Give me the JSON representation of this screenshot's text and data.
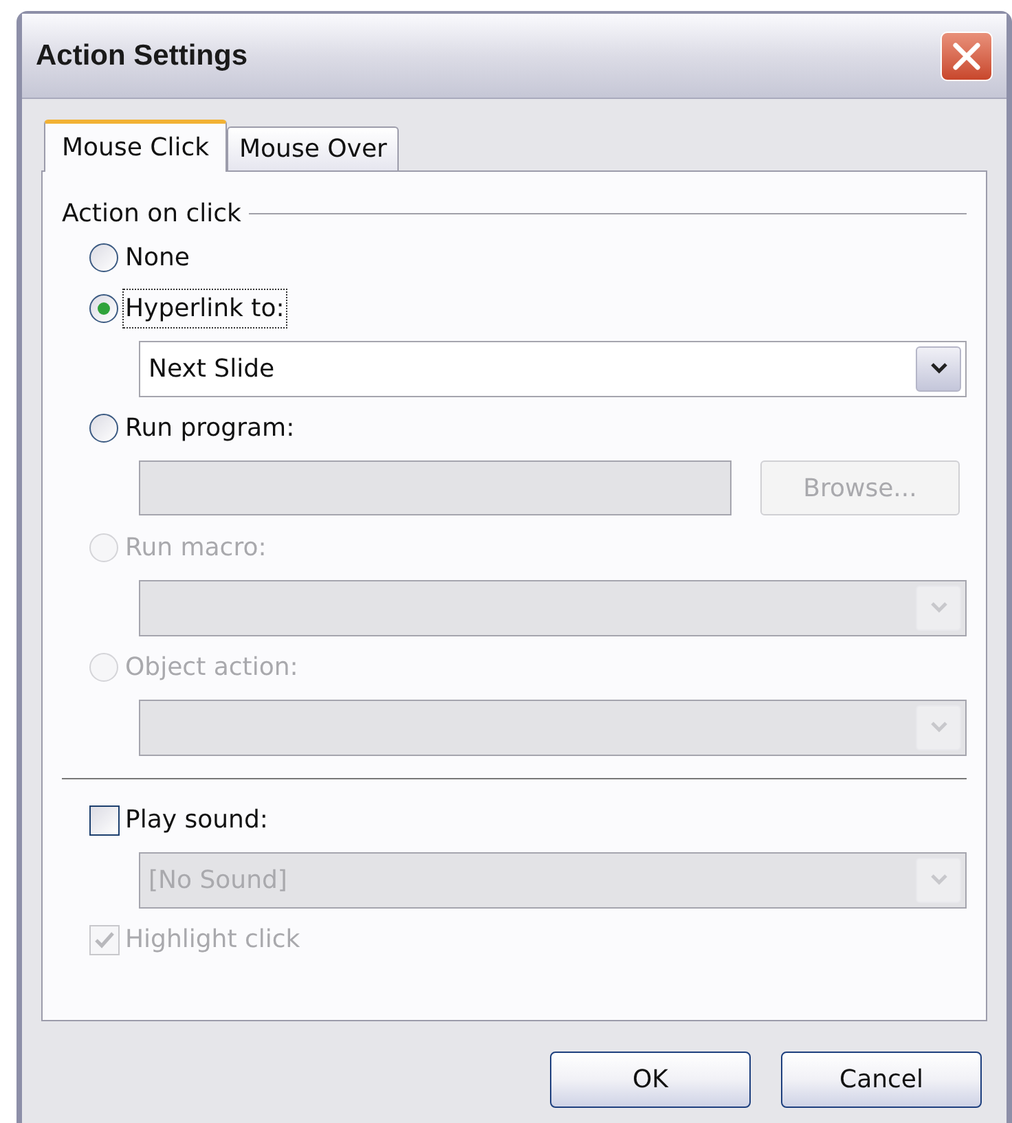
{
  "window": {
    "title": "Action Settings"
  },
  "tabs": [
    {
      "label": "Mouse Click",
      "selected": true
    },
    {
      "label": "Mouse Over",
      "selected": false
    }
  ],
  "group": {
    "label": "Action on click"
  },
  "options": [
    {
      "kind": "radio",
      "label": "None",
      "selected": false,
      "disabled": false
    },
    {
      "kind": "radio",
      "label": "Hyperlink to:",
      "selected": true,
      "disabled": false,
      "focused": true
    },
    {
      "kind": "dropdown",
      "value": "Next Slide",
      "disabled": false
    },
    {
      "kind": "radio",
      "label": "Run program:",
      "selected": false,
      "disabled": false
    },
    {
      "kind": "path",
      "button": "Browse...",
      "disabled": true
    },
    {
      "kind": "radio",
      "label": "Run macro:",
      "selected": false,
      "disabled": true
    },
    {
      "kind": "dropdown",
      "disabled": true
    },
    {
      "kind": "radio",
      "label": "Object action:",
      "selected": false,
      "disabled": true
    },
    {
      "kind": "dropdown",
      "disabled": true
    },
    {
      "kind": "divider"
    },
    {
      "kind": "checkbox",
      "label": "Play sound:",
      "checked": false,
      "disabled": false
    },
    {
      "kind": "dropdown",
      "value": "[No Sound]",
      "disabled": true
    },
    {
      "kind": "checkbox",
      "label": "Highlight click",
      "checked": true,
      "disabled": true
    }
  ],
  "buttons": [
    "OK",
    "Cancel"
  ]
}
